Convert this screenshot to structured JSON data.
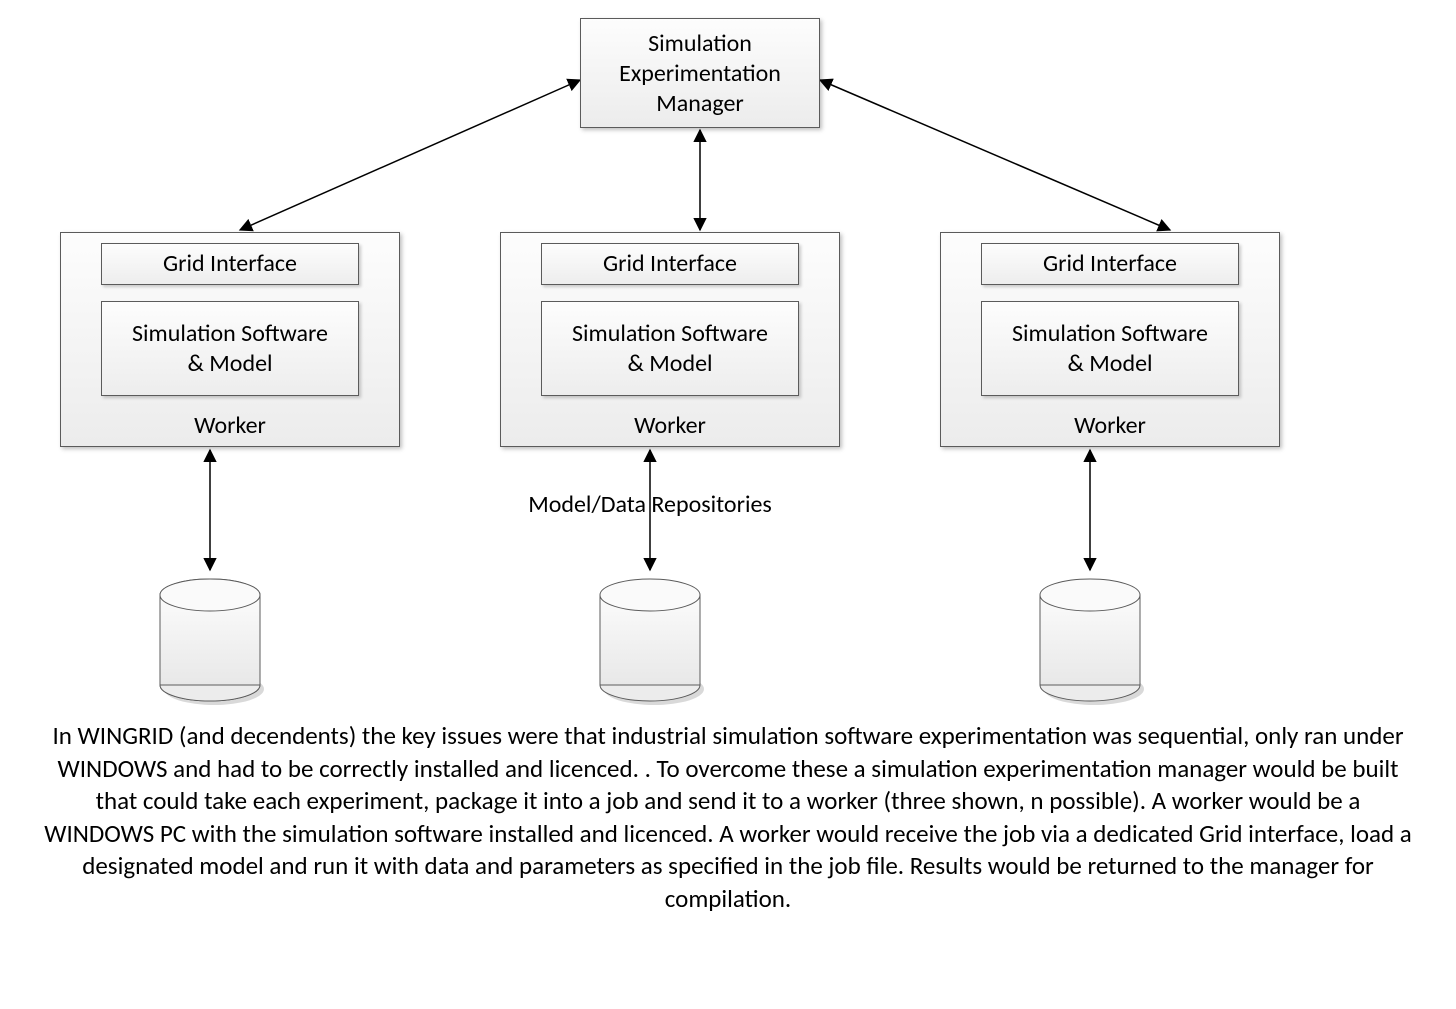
{
  "manager": {
    "label": "Simulation\nExperimentation\nManager"
  },
  "workers": [
    {
      "grid_label": "Grid Interface",
      "software_label": "Simulation Software\n& Model",
      "title": "Worker"
    },
    {
      "grid_label": "Grid Interface",
      "software_label": "Simulation Software\n& Model",
      "title": "Worker"
    },
    {
      "grid_label": "Grid Interface",
      "software_label": "Simulation Software\n& Model",
      "title": "Worker"
    }
  ],
  "repo_label": "Model/Data Repositories",
  "caption": "In WINGRID (and decendents) the key issues were that industrial simulation software experimentation was sequential, only ran under WINDOWS and had to be correctly installed and licenced. .  To overcome these a simulation experimentation manager would be built that could take each experiment, package it into a job and send it to a worker (three shown, n possible).  A worker would be a WINDOWS PC with the simulation software installed and licenced.  A worker would receive the job via a dedicated Grid interface, load a designated model and run it with data and parameters as specified in the job file.  Results would be returned to the manager for compilation."
}
